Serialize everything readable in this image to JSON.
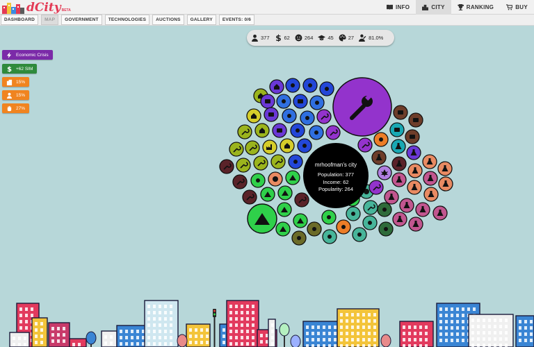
{
  "app": {
    "logo_text": "dCity",
    "logo_badge": "BETA"
  },
  "top_nav": [
    {
      "label": "INFO",
      "icon": "book-icon"
    },
    {
      "label": "CITY",
      "icon": "city-icon",
      "active": true
    },
    {
      "label": "RANKING",
      "icon": "trophy-icon"
    },
    {
      "label": "BUY",
      "icon": "cart-icon"
    }
  ],
  "tabs": [
    {
      "label": "DASHBOARD"
    },
    {
      "label": "MAP",
      "active": true
    },
    {
      "label": "GOVERNMENT"
    },
    {
      "label": "TECHNOLOGIES"
    },
    {
      "label": "AUCTIONS"
    },
    {
      "label": "GALLERY"
    },
    {
      "label": "EVENTS: 0/6"
    }
  ],
  "stats": {
    "population": "377",
    "income": "62",
    "popularity": "264",
    "education": "45",
    "culture": "27",
    "employment": "81.0%"
  },
  "badges": [
    {
      "label": "Economic Crisis",
      "icon": "lightning-icon",
      "color": "#7b2aa8"
    },
    {
      "label": "+62 SIM",
      "icon": "dollar-icon",
      "color": "#2f8a3c"
    },
    {
      "label": "15%",
      "icon": "building-icon",
      "color": "#f08420"
    },
    {
      "label": "15%",
      "icon": "worker-icon",
      "color": "#f08420"
    },
    {
      "label": "27%",
      "icon": "fist-icon",
      "color": "#f08420"
    }
  ],
  "city": {
    "name": "mrhoofman's city",
    "population_label": "Population: 377",
    "income_label": "Income: 62",
    "popularity_label": "Popularity: 264"
  },
  "colors": {
    "background": "#b7d7d9",
    "purple": "#9333cc",
    "green": "#2fd04a",
    "center": "#000000"
  }
}
